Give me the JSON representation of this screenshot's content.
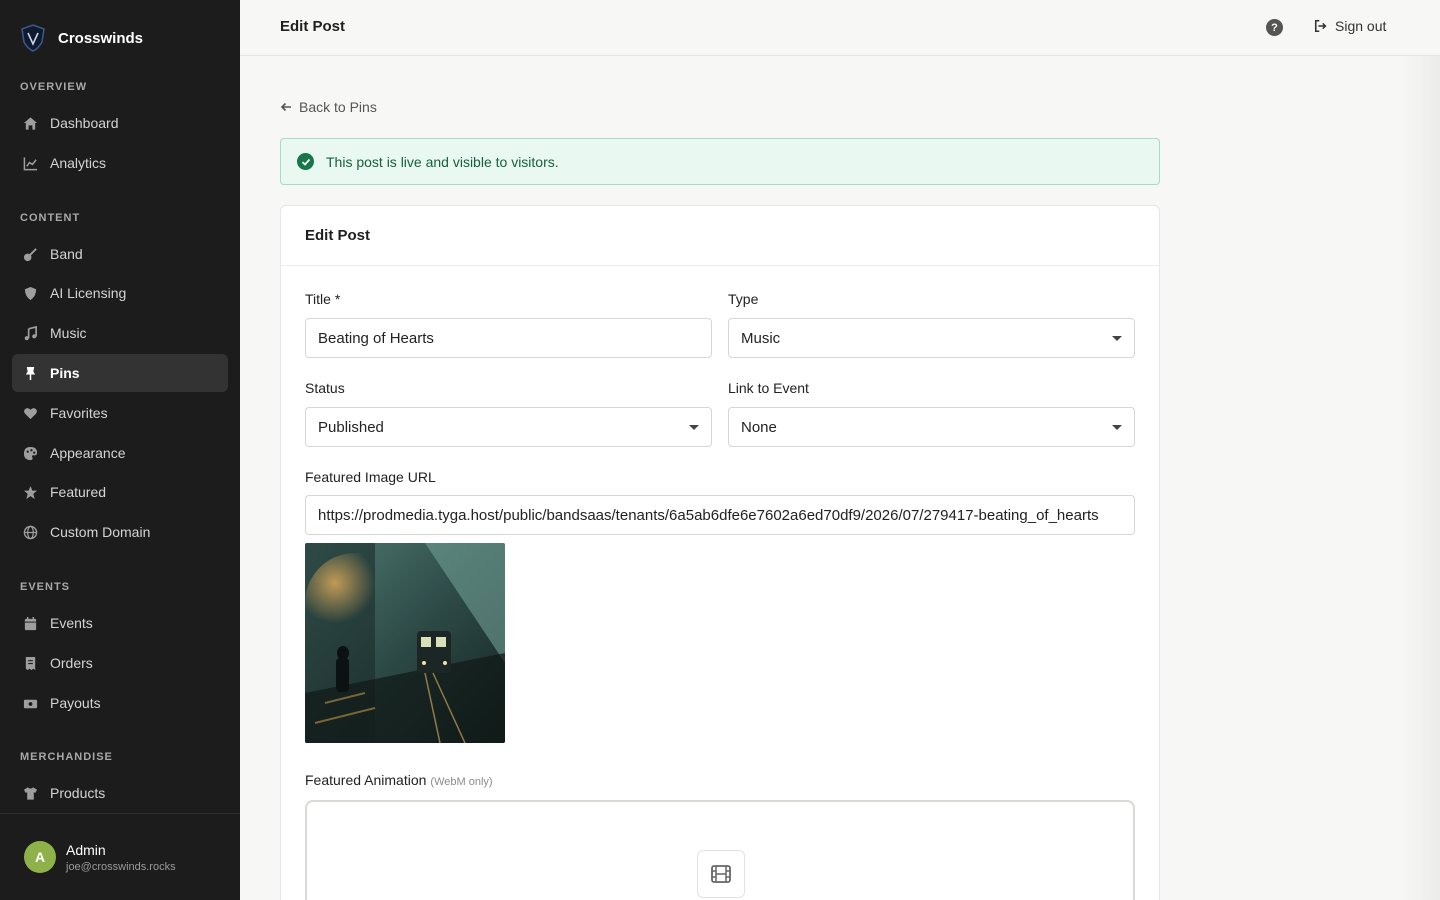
{
  "app": {
    "name": "Crosswinds"
  },
  "sidebar": {
    "sections": [
      {
        "label": "Overview",
        "items": [
          {
            "label": "Dashboard",
            "icon": "home-icon"
          },
          {
            "label": "Analytics",
            "icon": "chart-line-icon"
          }
        ]
      },
      {
        "label": "Content",
        "items": [
          {
            "label": "Band",
            "icon": "guitar-icon"
          },
          {
            "label": "AI Licensing",
            "icon": "shield-icon"
          },
          {
            "label": "Music",
            "icon": "music-icon"
          },
          {
            "label": "Pins",
            "icon": "pin-icon",
            "active": true
          },
          {
            "label": "Favorites",
            "icon": "heart-icon"
          },
          {
            "label": "Appearance",
            "icon": "palette-icon"
          },
          {
            "label": "Featured",
            "icon": "star-icon"
          },
          {
            "label": "Custom Domain",
            "icon": "globe-icon"
          }
        ]
      },
      {
        "label": "Events",
        "items": [
          {
            "label": "Events",
            "icon": "calendar-icon"
          },
          {
            "label": "Orders",
            "icon": "receipt-icon"
          },
          {
            "label": "Payouts",
            "icon": "money-icon"
          }
        ]
      },
      {
        "label": "Merchandise",
        "items": [
          {
            "label": "Products",
            "icon": "shirt-icon"
          }
        ]
      }
    ],
    "user": {
      "initial": "A",
      "name": "Admin",
      "email": "joe@crosswinds.rocks"
    }
  },
  "topbar": {
    "title": "Edit Post",
    "help": "?",
    "signout": "Sign out"
  },
  "main": {
    "back_link": "Back to Pins",
    "alert": "This post is live and visible to visitors.",
    "card_title": "Edit Post",
    "fields": {
      "title": {
        "label": "Title *",
        "value": "Beating of Hearts"
      },
      "type": {
        "label": "Type",
        "value": "Music"
      },
      "status": {
        "label": "Status",
        "value": "Published"
      },
      "link_event": {
        "label": "Link to Event",
        "value": "None"
      },
      "image_url": {
        "label": "Featured Image URL",
        "value": "https://prodmedia.tyga.host/public/bandsaas/tenants/6a5ab6dfe6e7602a6ed70df9/2026/07/279417-beating_of_hearts"
      },
      "animation": {
        "label": "Featured Animation",
        "hint": "(WebM only)"
      }
    }
  },
  "colors": {
    "sidebar_bg": "#1c1c1c",
    "success": "#17764a",
    "avatar": "#8fb14a"
  }
}
